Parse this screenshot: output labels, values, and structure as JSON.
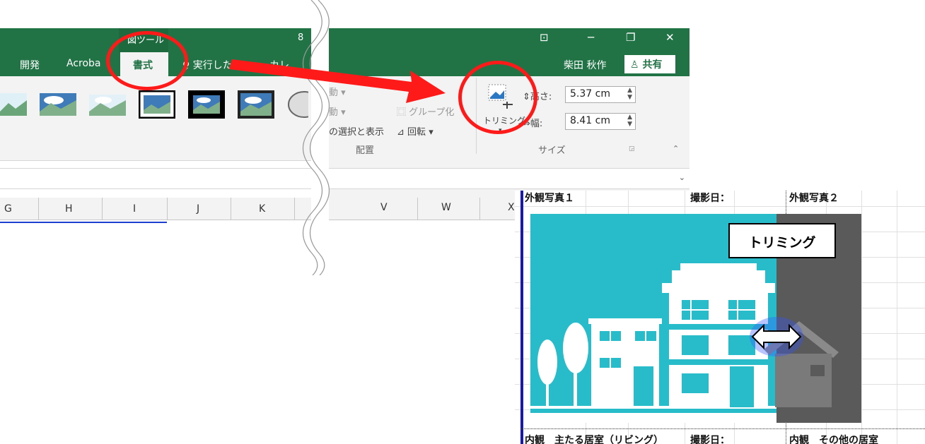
{
  "left_window": {
    "context_group": "図ツール",
    "title_fragment": "8",
    "tabs": [
      "開発",
      "Acroba",
      "書式"
    ],
    "active_tab": "書式",
    "tell_me": "実行した",
    "tell_me_fragment": "カレ",
    "columns": [
      "G",
      "H",
      "I",
      "J",
      "K"
    ]
  },
  "right_window": {
    "window_buttons": [
      "restore-ribbon",
      "minimize",
      "restore",
      "close"
    ],
    "user_name": "柴田 秋作",
    "share_label": "共有",
    "arrange": {
      "item1": "動",
      "item2": "動",
      "group_label_gray": "グループ化",
      "selection_pane": "の選択と表示",
      "rotate": "回転",
      "group_name": "配置"
    },
    "size": {
      "crop_label": "トリミング",
      "height_label": "高さ:",
      "height_value": "5.37 cm",
      "width_label": "幅:",
      "width_value": "8.41 cm",
      "group_name": "サイズ"
    },
    "columns": [
      "V",
      "W",
      "X"
    ]
  },
  "sheet": {
    "top_left": "外観写真１",
    "top_date": "撮影日：",
    "top_right": "外観写真２",
    "bottom_left": "内観　主たる居室（リビング）",
    "bottom_date": "撮影日：",
    "bottom_right": "内観　その他の居室",
    "callout": "トリミング"
  },
  "colors": {
    "excel_green": "#217346",
    "annotation_red": "#ff1a1a",
    "image_teal": "#28bccb",
    "cropped_gray": "#5a5a5a"
  }
}
